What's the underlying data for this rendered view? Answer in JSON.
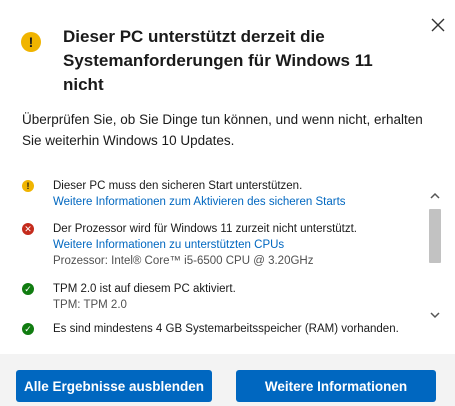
{
  "dialog": {
    "title": "Dieser PC unterstützt derzeit die Systemanforderungen für Windows 11 nicht",
    "header_icon": "warning-icon",
    "intro": "Überprüfen Sie, ob Sie Dinge tun können, und wenn nicht, erhalten Sie weiterhin Windows 10 Updates."
  },
  "results": [
    {
      "status": "warning",
      "icon_glyph": "!",
      "text": "Dieser PC muss den sicheren Start unterstützen.",
      "link": "Weitere Informationen zum Aktivieren des sicheren Starts",
      "detail": ""
    },
    {
      "status": "error",
      "icon_glyph": "✕",
      "text": "Der Prozessor wird für Windows 11 zurzeit nicht unterstützt.",
      "link": "Weitere Informationen zu unterstützten CPUs",
      "detail": "Prozessor: Intel® Core™ i5-6500 CPU @ 3.20GHz"
    },
    {
      "status": "ok",
      "icon_glyph": "✓",
      "text": "TPM 2.0 ist auf diesem PC aktiviert.",
      "link": "",
      "detail": "TPM: TPM 2.0"
    },
    {
      "status": "ok",
      "icon_glyph": "✓",
      "text": "Es sind mindestens 4 GB Systemarbeitsspeicher (RAM) vorhanden.",
      "link": "",
      "detail": ""
    }
  ],
  "footer": {
    "hide_results_label": "Alle Ergebnisse ausblenden",
    "more_info_label": "Weitere Informationen"
  },
  "colors": {
    "accent": "#0067c0",
    "warning": "#f0b400",
    "error": "#c42b1c",
    "ok": "#107c10"
  }
}
